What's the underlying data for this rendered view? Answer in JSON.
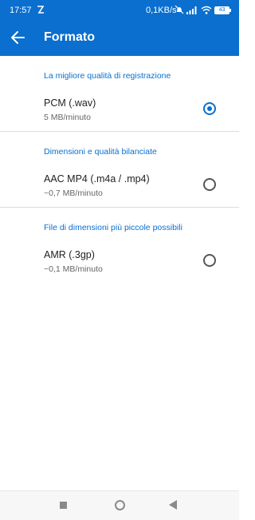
{
  "status_bar": {
    "time": "17:57",
    "network_speed": "0,1KB/s",
    "battery": "43",
    "icons": [
      "notification-icon",
      "mute-icon",
      "signal-icon",
      "wifi-icon",
      "battery-icon"
    ]
  },
  "app_bar": {
    "title": "Formato",
    "back_icon": "arrow-left-icon"
  },
  "sections": [
    {
      "header": "La migliore qualità di registrazione",
      "option": {
        "name": "PCM (.wav)",
        "desc": "5 MB/minuto",
        "selected": true
      }
    },
    {
      "header": "Dimensioni e qualità bilanciate",
      "option": {
        "name": "AAC MP4 (.m4a / .mp4)",
        "desc": "~0,7 MB/minuto",
        "selected": false
      }
    },
    {
      "header": "File di dimensioni più piccole possibili",
      "option": {
        "name": "AMR (.3gp)",
        "desc": "~0,1 MB/minuto",
        "selected": false
      }
    }
  ],
  "nav_bar": {
    "icons": [
      "recent-apps-icon",
      "home-icon",
      "back-icon"
    ]
  },
  "colors": {
    "accent": "#0a6fcf",
    "divider": "#dcdcdc"
  }
}
